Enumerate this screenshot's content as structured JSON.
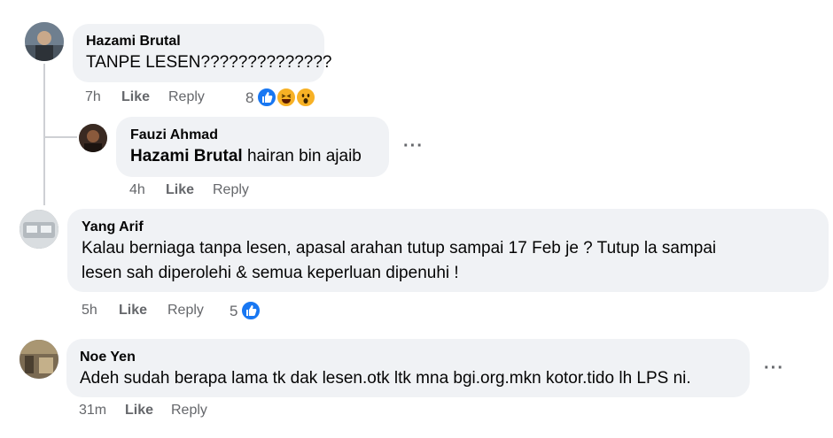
{
  "comments": [
    {
      "author": "Hazami Brutal",
      "text": "TANPE LESEN??????????????",
      "time": "7h",
      "like_label": "Like",
      "reply_label": "Reply",
      "reaction_count": "8",
      "reactions": [
        "like-icon",
        "haha-icon",
        "wow-icon"
      ]
    },
    {
      "author": "Fauzi Ahmad",
      "mention": "Hazami Brutal",
      "text": " hairan bin ajaib",
      "time": "4h",
      "like_label": "Like",
      "reply_label": "Reply",
      "more_label": "···"
    },
    {
      "author": "Yang Arif",
      "text_line1": "Kalau berniaga tanpa lesen, apasal arahan tutup sampai 17 Feb je ? Tutup la sampai",
      "text_line2": "lesen sah diperolehi & semua keperluan dipenuhi !",
      "time": "5h",
      "like_label": "Like",
      "reply_label": "Reply",
      "reaction_count": "5",
      "reactions": [
        "like-icon"
      ]
    },
    {
      "author": "Noe Yen",
      "text": "Adeh sudah berapa lama tk dak lesen.otk ltk mna bgi.org.mkn kotor.tido lh LPS ni.",
      "time": "31m",
      "like_label": "Like",
      "reply_label": "Reply",
      "more_label": "···"
    }
  ],
  "colors": {
    "bubble": "#f0f2f5",
    "meta": "#65676b",
    "like_blue": "#1877f2",
    "emoji_yellow": "#f7b125"
  }
}
